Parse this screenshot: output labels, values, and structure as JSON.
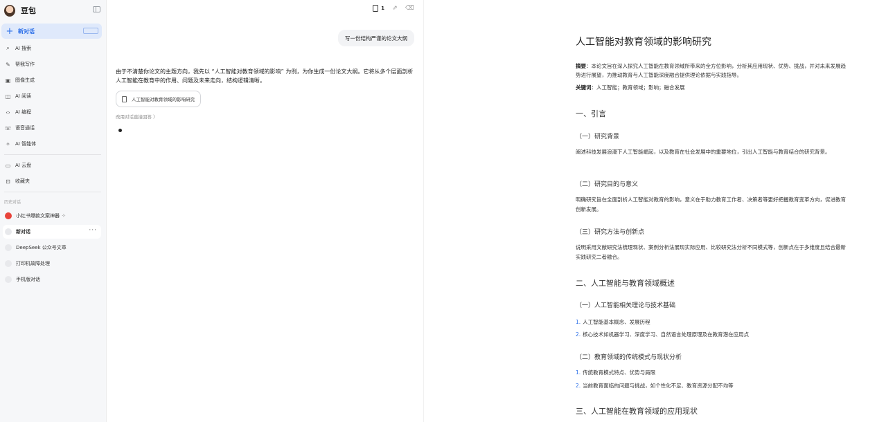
{
  "sidebar": {
    "brand": "豆包",
    "new_chat": "新对话",
    "nav": [
      {
        "icon": "search-icon",
        "glyph": "⌕",
        "label": "AI 搜索"
      },
      {
        "icon": "pen-icon",
        "glyph": "✎",
        "label": "帮我写作"
      },
      {
        "icon": "image-icon",
        "glyph": "▣",
        "label": "图像生成"
      },
      {
        "icon": "book-icon",
        "glyph": "◫",
        "label": "AI 阅读"
      },
      {
        "icon": "code-icon",
        "glyph": "‹›",
        "label": "AI 编程"
      },
      {
        "icon": "phone-icon",
        "glyph": "☏",
        "label": "语音通话"
      },
      {
        "icon": "sparkle-icon",
        "glyph": "✧",
        "label": "AI 智能体"
      },
      {
        "icon": "cloud-drive-icon",
        "glyph": "▭",
        "label": "AI 云盘"
      },
      {
        "icon": "bookmark-icon",
        "glyph": "⊡",
        "label": "收藏夹"
      }
    ],
    "history_label": "历史对话",
    "history": [
      {
        "label": "小红书爆款文案神器",
        "suffix": "✧"
      },
      {
        "label": "新对话",
        "more": "···"
      },
      {
        "label": "DeepSeek 公众号文章"
      },
      {
        "label": "打印机故障处理"
      },
      {
        "label": "手机版对话"
      }
    ]
  },
  "chat": {
    "doc_count": "1",
    "user_message": "写一份结构严谨的论文大纲",
    "reply": "由于不清楚你论文的主题方向，我先以 “人工智能对教育领域的影响” 为例，为你生成一份论文大纲。它将从多个层面剖析人工智能在教育中的作用、问题及未来走向，结构逻辑清晰。",
    "doc_card_title": "人工智能对教育领域的影响研究",
    "switch_link": "改用对话直接回答 〉"
  },
  "document": {
    "title": "人工智能对教育领域的影响研究",
    "abstract_label": "摘要",
    "abstract_text": "：本论文旨在深入探究人工智能在教育领域所带来的全方位影响，分析其应用现状、优势、挑战，并对未来发展趋势进行展望，为推动教育与人工智能深度融合提供理论依据与实践指导。",
    "keywords_label": "关键词",
    "keywords_text": "：人工智能；教育领域；影响；融合发展",
    "s1": "一、引言",
    "s1_1": "（一）研究背景",
    "s1_1_text": "阐述科技发展浪潮下人工智能崛起，以及教育在社会发展中的重要地位，引出人工智能与教育结合的研究背景。",
    "s1_2": "（二）研究目的与意义",
    "s1_2_text": "明确研究旨在全面剖析人工智能对教育的影响，意义在于助力教育工作者、决策者等更好把握教育变革方向，促进教育创新发展。",
    "s1_3": "（三）研究方法与创新点",
    "s1_3_text": "说明采用文献研究法梳理现状、案例分析法展现实际应用、比较研究法分析不同模式等，创新点在于多维度且结合最新实践研究二者融合。",
    "s2": "二、人工智能与教育领域概述",
    "s2_1": "（一）人工智能相关理论与技术基础",
    "s2_1_items": [
      "人工智能基本概念、发展历程",
      "核心技术如机器学习、深度学习、自然语言处理原理及在教育潜在应用点"
    ],
    "s2_2": "（二）教育领域的传统模式与现状分析",
    "s2_2_items": [
      "传统教育模式特点、优势与局限",
      "当前教育面临的问题与挑战，如个性化不足、教育资源分配不均等"
    ],
    "s3": "三、人工智能在教育领域的应用现状"
  },
  "colors": {
    "accent": "#2a6ee8",
    "active_bg": "#dfe9fb"
  }
}
